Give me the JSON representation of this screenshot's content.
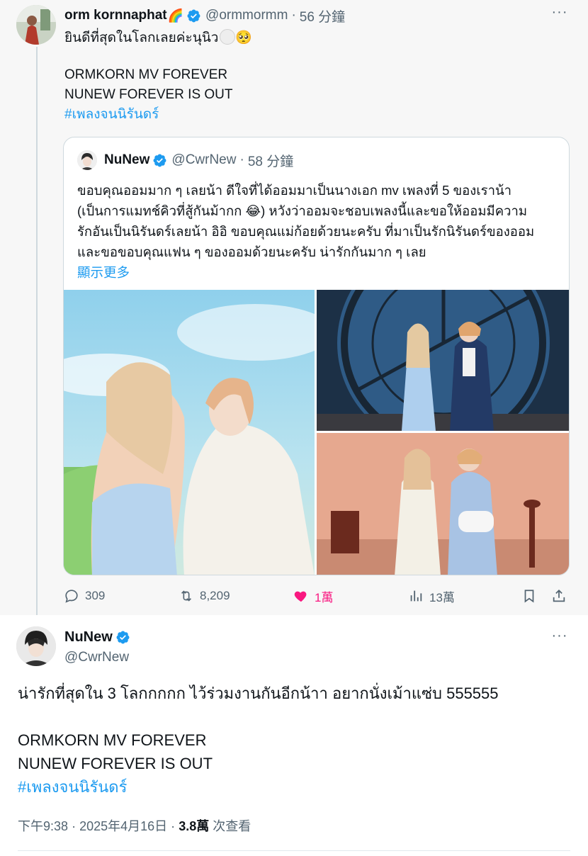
{
  "parent_tweet": {
    "name": "orm kornnaphat",
    "name_emoji": "🌈",
    "handle": "@ormmormm",
    "time": "56 分鐘",
    "text": {
      "line1": "ยินดีที่สุดในโลกเลยค่ะนุนิว",
      "line1_emoji": "🥺",
      "line2": "ORMKORN MV FOREVER",
      "line3": "NUNEW FOREVER IS OUT",
      "hashtag": "#เพลงจนนิรันดร์"
    },
    "quote": {
      "name": "NuNew",
      "handle": "@CwrNew",
      "time": "58 分鐘",
      "lines": [
        "ขอบคุณออมมาก ๆ เลยน้า ดีใจที่ได้ออมมาเป็นนางเอก mv เพลงที่ 5 ของเราน้า",
        "(เป็นการแมทช์คิวที่สู้กันม้ากก 😂) หวังว่าออมจะชอบเพลงนี้และขอให้ออมมีความ",
        "รักอันเป็นนิรันดร์เลยน้า อิอิ ขอบคุณแม่ก้อยด้วยนะครับ ที่มาเป็นรักนิรันดร์ของออม",
        "และขอขอบคุณแฟน ๆ ของออมด้วยนะครับ น่ารักกันมาก ๆ เลย"
      ],
      "show_more": "顯示更多"
    },
    "actions": {
      "replies": "309",
      "reposts": "8,209",
      "likes": "1萬",
      "views": "13萬"
    }
  },
  "main_tweet": {
    "name": "NuNew",
    "handle": "@CwrNew",
    "lines": [
      "น่ารักที่สุดใน 3 โลกกกกก ไว้ร่วมงานกันอีกน้าา อยากนั่งเม้าแซ่บ 555555",
      "ORMKORN MV FOREVER",
      "NUNEW FOREVER IS OUT",
      "#เพลงจนนิรันดร์"
    ],
    "meta": {
      "time": "下午9:38",
      "date": "2025年4月16日",
      "views_count": "3.8萬",
      "views_label": "次查看",
      "sep": "·"
    }
  },
  "colors": {
    "accent": "#1d9bf0",
    "like": "#f91880",
    "secondary_text": "#536471",
    "border": "#cfd9de"
  },
  "icons": [
    "verified-badge-icon",
    "more-dots-icon",
    "reply-icon",
    "repost-icon",
    "heart-icon",
    "views-icon",
    "bookmark-icon",
    "share-icon"
  ]
}
